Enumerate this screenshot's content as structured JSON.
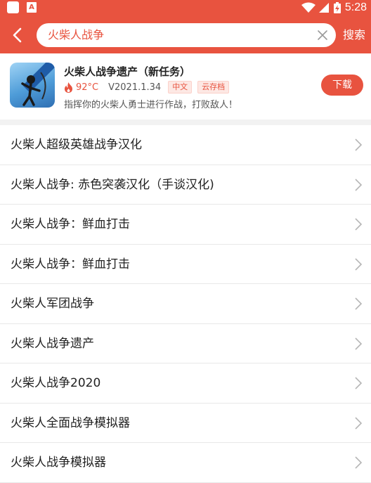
{
  "status_bar": {
    "time": "5:28",
    "left_badge": "A"
  },
  "search": {
    "query": "火柴人战争",
    "search_label": "搜索"
  },
  "featured_app": {
    "title": "火柴人战争遗产（新任务）",
    "temperature": "92°C",
    "version": "V2021.1.34",
    "tags": [
      "中文",
      "云存档"
    ],
    "description": "指挥你的火柴人勇士进行作战，打败敌人！",
    "download_label": "下载"
  },
  "results": [
    {
      "label": "火柴人超级英雄战争汉化"
    },
    {
      "label": "火柴人战争: 赤色突袭汉化（手谈汉化)"
    },
    {
      "label": "火柴人战争：鲜血打击"
    },
    {
      "label": "火柴人战争：鲜血打击"
    },
    {
      "label": "火柴人军团战争"
    },
    {
      "label": "火柴人战争遗产"
    },
    {
      "label": "火柴人战争2020"
    },
    {
      "label": "火柴人全面战争模拟器"
    },
    {
      "label": "火柴人战争模拟器"
    }
  ],
  "colors": {
    "accent": "#e8533f",
    "tag_bg": "#fde8e4",
    "divider": "#e8e8e8"
  }
}
